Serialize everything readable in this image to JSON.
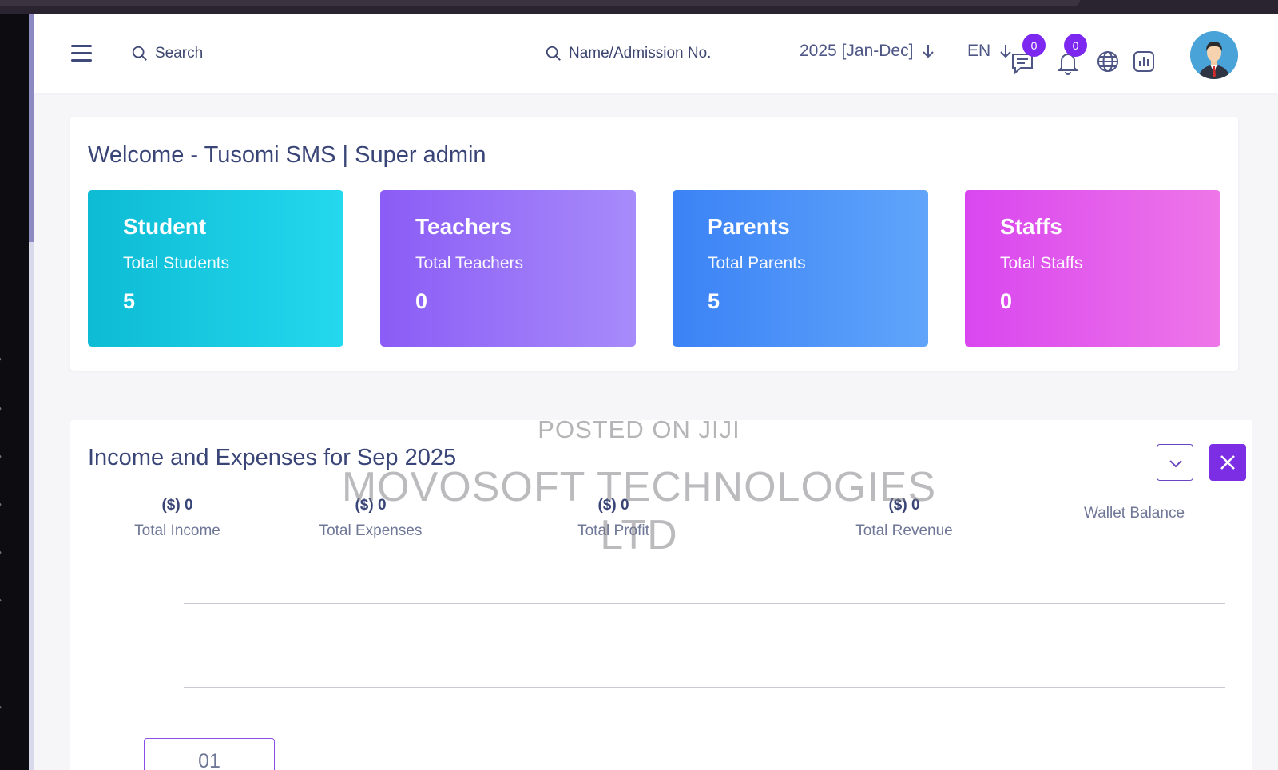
{
  "header": {
    "search_label": "Search",
    "admission_search_label": "Name/Admission No.",
    "session_label": "2025 [Jan-Dec]",
    "language_label": "EN",
    "messages_count": "0",
    "notifications_count": "0"
  },
  "welcome": {
    "title": "Welcome - Tusomi SMS | Super admin",
    "cards": [
      {
        "title": "Student",
        "subtitle": "Total Students",
        "value": "5"
      },
      {
        "title": "Teachers",
        "subtitle": "Total Teachers",
        "value": "0"
      },
      {
        "title": "Parents",
        "subtitle": "Total Parents",
        "value": "5"
      },
      {
        "title": "Staffs",
        "subtitle": "Total Staffs",
        "value": "0"
      }
    ]
  },
  "income": {
    "title": "Income and Expenses for Sep 2025",
    "metrics": [
      {
        "value": "($) 0",
        "label": "Total Income"
      },
      {
        "value": "($) 0",
        "label": "Total Expenses"
      },
      {
        "value": "($) 0",
        "label": "Total Profit"
      },
      {
        "value": "($) 0",
        "label": "Total Revenue"
      },
      {
        "label": "Wallet Balance"
      }
    ],
    "tooltip_label": "01"
  },
  "watermark": {
    "line1": "POSTED ON JIJI",
    "line2": "MOVOSOFT TECHNOLOGIES LTD"
  },
  "colors": {
    "student": "#0dbbd4",
    "teachers": "#8b5cf6",
    "parents": "#3b82f6",
    "staffs": "#d946ef",
    "accent": "#7c28f0"
  },
  "icons": [
    "hamburger-icon",
    "search-icon",
    "arrow-down-icon",
    "chat-icon",
    "bell-icon",
    "globe-icon",
    "chart-icon",
    "chevron-down-icon",
    "close-icon"
  ]
}
